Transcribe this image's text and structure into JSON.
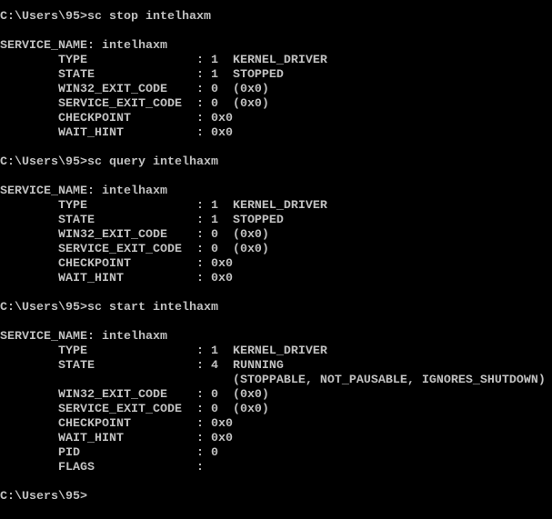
{
  "console": {
    "text_color": "#c0c0c0",
    "background_color": "#000000",
    "lines": [
      "C:\\Users\\95>sc stop intelhaxm",
      "",
      "SERVICE_NAME: intelhaxm",
      "        TYPE               : 1  KERNEL_DRIVER",
      "        STATE              : 1  STOPPED",
      "        WIN32_EXIT_CODE    : 0  (0x0)",
      "        SERVICE_EXIT_CODE  : 0  (0x0)",
      "        CHECKPOINT         : 0x0",
      "        WAIT_HINT          : 0x0",
      "",
      "C:\\Users\\95>sc query intelhaxm",
      "",
      "SERVICE_NAME: intelhaxm",
      "        TYPE               : 1  KERNEL_DRIVER",
      "        STATE              : 1  STOPPED",
      "        WIN32_EXIT_CODE    : 0  (0x0)",
      "        SERVICE_EXIT_CODE  : 0  (0x0)",
      "        CHECKPOINT         : 0x0",
      "        WAIT_HINT          : 0x0",
      "",
      "C:\\Users\\95>sc start intelhaxm",
      "",
      "SERVICE_NAME: intelhaxm",
      "        TYPE               : 1  KERNEL_DRIVER",
      "        STATE              : 4  RUNNING",
      "                                (STOPPABLE, NOT_PAUSABLE, IGNORES_SHUTDOWN)",
      "        WIN32_EXIT_CODE    : 0  (0x0)",
      "        SERVICE_EXIT_CODE  : 0  (0x0)",
      "        CHECKPOINT         : 0x0",
      "        WAIT_HINT          : 0x0",
      "        PID                : 0",
      "        FLAGS              :",
      "",
      "C:\\Users\\95>"
    ]
  }
}
